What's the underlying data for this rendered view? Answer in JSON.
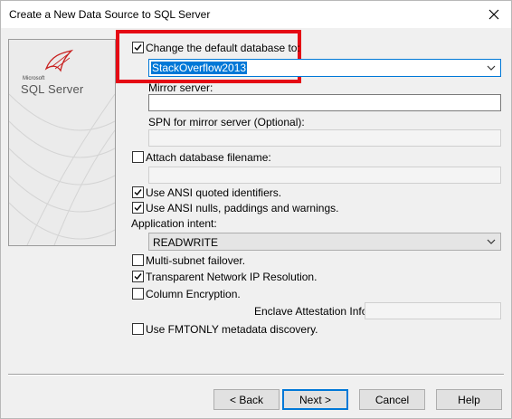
{
  "window": {
    "title": "Create a New Data Source to SQL Server"
  },
  "logo": {
    "microsoft": "Microsoft",
    "sql": "SQL Server"
  },
  "default_db": {
    "label": "Change the default database to:",
    "checked": true,
    "value": "StackOverflow2013"
  },
  "mirror": {
    "label": "Mirror server:",
    "value": ""
  },
  "spn": {
    "label": "SPN for mirror server (Optional):",
    "value": ""
  },
  "attach": {
    "label": "Attach database filename:",
    "checked": false,
    "value": ""
  },
  "ansi_quoted": {
    "label": "Use ANSI quoted identifiers.",
    "checked": true
  },
  "ansi_nulls": {
    "label": "Use ANSI nulls, paddings and warnings.",
    "checked": true
  },
  "app_intent": {
    "label": "Application intent:",
    "value": "READWRITE"
  },
  "multi_subnet": {
    "label": "Multi-subnet failover.",
    "checked": false
  },
  "tnir": {
    "label": "Transparent Network IP Resolution.",
    "checked": true
  },
  "column_enc": {
    "label": "Column Encryption.",
    "checked": false
  },
  "enclave": {
    "label": "Enclave Attestation Info:",
    "value": ""
  },
  "fmtonly": {
    "label": "Use FMTONLY metadata discovery.",
    "checked": false
  },
  "buttons": {
    "back": "< Back",
    "next": "Next >",
    "cancel": "Cancel",
    "help": "Help"
  },
  "colors": {
    "highlight": "#e50914",
    "selection": "#0078d7"
  }
}
